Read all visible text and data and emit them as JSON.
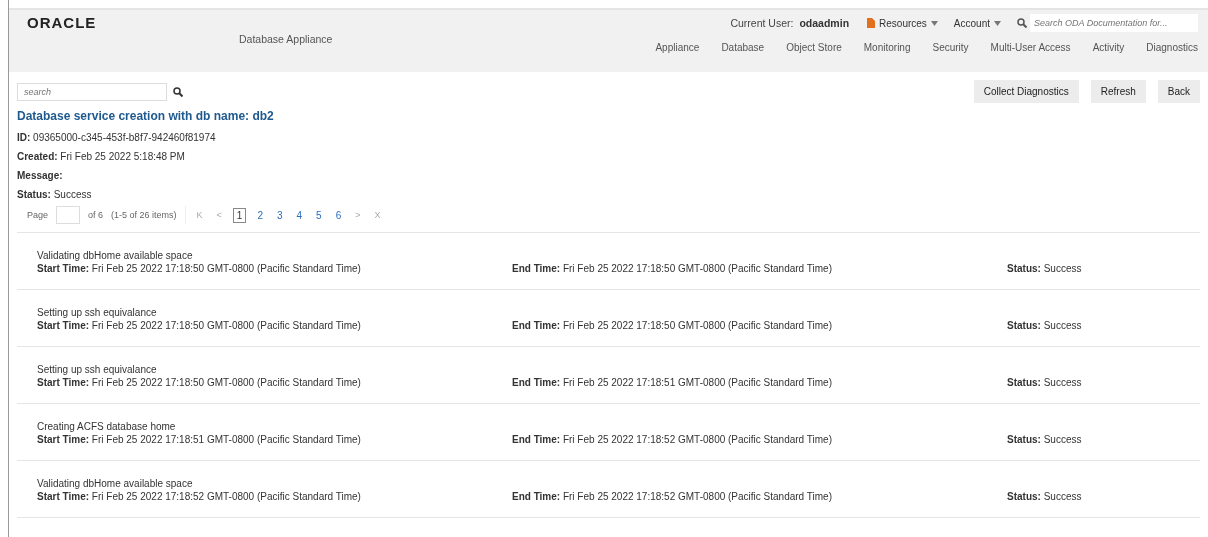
{
  "header": {
    "logo": "ORACLE",
    "product": "Database Appliance",
    "user_label": "Current User:",
    "user_name": "odaadmin",
    "menus": [
      {
        "label": "Resources",
        "kind": "document"
      },
      {
        "label": "Account",
        "kind": "plain"
      }
    ],
    "search": {
      "placeholder": "Search ODA Documentation for..."
    },
    "nav": [
      "Appliance",
      "Database",
      "Object Store",
      "Monitoring",
      "Security",
      "Multi-User Access",
      "Activity",
      "Diagnostics"
    ]
  },
  "toolbar": {
    "search": {
      "placeholder": "search"
    },
    "buttons": [
      "Collect Diagnostics",
      "Refresh",
      "Back"
    ]
  },
  "job": {
    "title": "Database service creation with db name: db2",
    "fields": [
      "**ID:** 09365000-c345-453f-b8f7-942460f81974",
      "**Created:** Fri Feb 25 2022 5:18:48 PM",
      "**Message:**",
      "**Status:** Success"
    ]
  },
  "pagination": {
    "label": "Page",
    "of": "of 6",
    "range": "(1-5 of 26 items)",
    "first": "K",
    "prev": "<",
    "next": ">",
    "last": "X",
    "pages": [
      {
        "label": "1",
        "selected": true
      },
      {
        "label": "2",
        "selected": false
      },
      {
        "label": "3",
        "selected": false
      },
      {
        "label": "4",
        "selected": false
      },
      {
        "label": "5",
        "selected": false
      },
      {
        "label": "6",
        "selected": false
      }
    ]
  },
  "tasks": [
    {
      "name": "Validating dbHome available space",
      "start": "**Start Time:** Fri Feb 25 2022 17:18:50 GMT-0800 (Pacific Standard Time)",
      "end": "**End Time:** Fri Feb 25 2022 17:18:50 GMT-0800 (Pacific Standard Time)",
      "status": "**Status:** Success"
    },
    {
      "name": "Setting up ssh equivalance",
      "start": "**Start Time:** Fri Feb 25 2022 17:18:50 GMT-0800 (Pacific Standard Time)",
      "end": "**End Time:** Fri Feb 25 2022 17:18:50 GMT-0800 (Pacific Standard Time)",
      "status": "**Status:** Success"
    },
    {
      "name": "Setting up ssh equivalance",
      "start": "**Start Time:** Fri Feb 25 2022 17:18:50 GMT-0800 (Pacific Standard Time)",
      "end": "**End Time:** Fri Feb 25 2022 17:18:51 GMT-0800 (Pacific Standard Time)",
      "status": "**Status:** Success"
    },
    {
      "name": "Creating ACFS database home",
      "start": "**Start Time:** Fri Feb 25 2022 17:18:51 GMT-0800 (Pacific Standard Time)",
      "end": "**End Time:** Fri Feb 25 2022 17:18:52 GMT-0800 (Pacific Standard Time)",
      "status": "**Status:** Success"
    },
    {
      "name": "Validating dbHome available space",
      "start": "**Start Time:** Fri Feb 25 2022 17:18:52 GMT-0800 (Pacific Standard Time)",
      "end": "**End Time:** Fri Feb 25 2022 17:18:52 GMT-0800 (Pacific Standard Time)",
      "status": "**Status:** Success"
    }
  ]
}
